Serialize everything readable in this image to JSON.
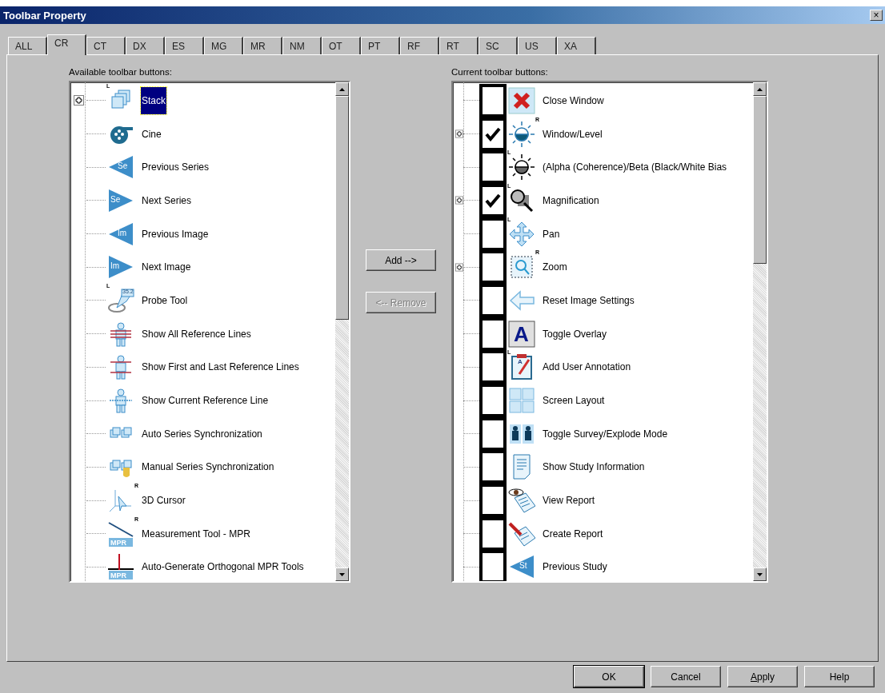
{
  "window": {
    "title": "Toolbar Property",
    "close": "×"
  },
  "tabs": [
    {
      "label": "ALL",
      "selected": false
    },
    {
      "label": "CR",
      "selected": true
    },
    {
      "label": "CT",
      "selected": false
    },
    {
      "label": "DX",
      "selected": false
    },
    {
      "label": "ES",
      "selected": false
    },
    {
      "label": "MG",
      "selected": false
    },
    {
      "label": "MR",
      "selected": false
    },
    {
      "label": "NM",
      "selected": false
    },
    {
      "label": "OT",
      "selected": false
    },
    {
      "label": "PT",
      "selected": false
    },
    {
      "label": "RF",
      "selected": false
    },
    {
      "label": "RT",
      "selected": false
    },
    {
      "label": "SC",
      "selected": false
    },
    {
      "label": "US",
      "selected": false
    },
    {
      "label": "XA",
      "selected": false
    }
  ],
  "available": {
    "label": "Available toolbar buttons:",
    "items": [
      {
        "label": "Stack",
        "selected": true,
        "collapsed": true,
        "marker": "L"
      },
      {
        "label": "Cine",
        "selected": false,
        "collapsed": false
      },
      {
        "label": "Previous Series",
        "selected": false,
        "collapsed": false,
        "icon_text": "Se"
      },
      {
        "label": "Next Series",
        "selected": false,
        "collapsed": false,
        "icon_text": "Se"
      },
      {
        "label": "Previous Image",
        "selected": false,
        "collapsed": false,
        "icon_text": "Im"
      },
      {
        "label": "Next Image",
        "selected": false,
        "collapsed": false,
        "icon_text": "Im"
      },
      {
        "label": "Probe Tool",
        "selected": false,
        "collapsed": false,
        "marker": "L",
        "icon_text": "35.2"
      },
      {
        "label": "Show All Reference Lines",
        "selected": false,
        "collapsed": false
      },
      {
        "label": "Show First and Last Reference Lines",
        "selected": false,
        "collapsed": false
      },
      {
        "label": "Show Current Reference Line",
        "selected": false,
        "collapsed": false
      },
      {
        "label": "Auto Series Synchronization",
        "selected": false,
        "collapsed": false
      },
      {
        "label": "Manual Series Synchronization",
        "selected": false,
        "collapsed": false
      },
      {
        "label": "3D Cursor",
        "selected": false,
        "collapsed": false,
        "marker": "R"
      },
      {
        "label": "Measurement Tool - MPR",
        "selected": false,
        "collapsed": false,
        "marker": "R",
        "icon_text": "MPR"
      },
      {
        "label": "Auto-Generate Orthogonal MPR Tools",
        "selected": false,
        "collapsed": false,
        "icon_text": "MPR"
      }
    ]
  },
  "current": {
    "label": "Current toolbar buttons:",
    "items": [
      {
        "label": "Close Window",
        "checked": false,
        "collapsed": false
      },
      {
        "label": "Window/Level",
        "checked": true,
        "collapsed": true,
        "marker": "R"
      },
      {
        "label": "(Alpha (Coherence)/Beta (Black/White Bias",
        "checked": false,
        "collapsed": false,
        "marker": "L"
      },
      {
        "label": "Magnification",
        "checked": true,
        "collapsed": true,
        "marker": "L"
      },
      {
        "label": "Pan",
        "checked": false,
        "collapsed": false,
        "marker": "L"
      },
      {
        "label": "Zoom",
        "checked": false,
        "collapsed": true,
        "marker": "R"
      },
      {
        "label": "Reset Image Settings",
        "checked": false,
        "collapsed": false
      },
      {
        "label": "Toggle Overlay",
        "checked": false,
        "collapsed": false,
        "icon_text": "A"
      },
      {
        "label": "Add User Annotation",
        "checked": false,
        "collapsed": false,
        "marker": "L",
        "icon_text": "A"
      },
      {
        "label": "Screen Layout",
        "checked": false,
        "collapsed": false
      },
      {
        "label": "Toggle Survey/Explode Mode",
        "checked": false,
        "collapsed": false
      },
      {
        "label": "Show Study Information",
        "checked": false,
        "collapsed": false
      },
      {
        "label": "View Report",
        "checked": false,
        "collapsed": false
      },
      {
        "label": "Create Report",
        "checked": false,
        "collapsed": false
      },
      {
        "label": "Previous Study",
        "checked": false,
        "collapsed": false,
        "icon_text": "St"
      }
    ]
  },
  "middle_buttons": [
    {
      "label": "Add -->",
      "disabled": false
    },
    {
      "label": "<-- Remove",
      "disabled": true
    }
  ],
  "footer_buttons": [
    {
      "label": "OK",
      "default": true,
      "underline_first": false
    },
    {
      "label": "Cancel",
      "default": false,
      "underline_first": false
    },
    {
      "label": "Apply",
      "default": false,
      "underline_first": true
    },
    {
      "label": "Help",
      "default": false,
      "underline_first": false
    }
  ]
}
